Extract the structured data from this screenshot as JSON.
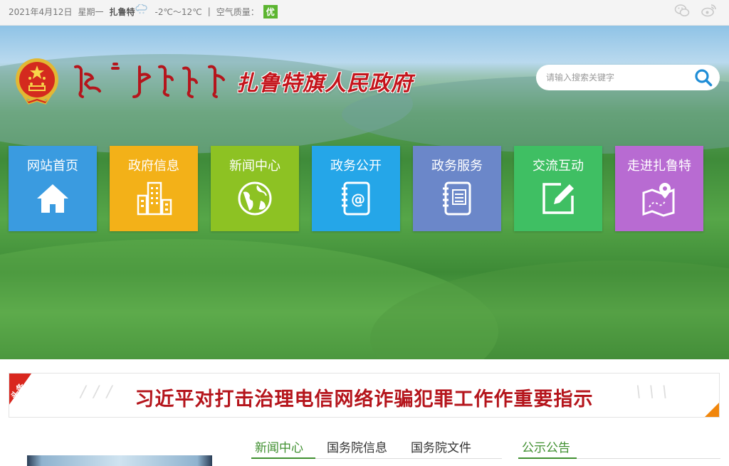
{
  "topbar": {
    "date": "2021年4月12日",
    "weekday": "星期一",
    "city": "扎鲁特",
    "temperature": "-2℃～12℃",
    "divider": "|",
    "air_quality_label": "空气质量：",
    "air_quality_value": "优",
    "air_quality_color": "#5cb531",
    "weather_icon": "snow-cloud-icon",
    "social_icons": [
      "wechat-icon",
      "weibo-icon"
    ]
  },
  "header": {
    "title": "扎鲁特旗人民政府",
    "title_color": "#c4141b",
    "emblem": "national-emblem-icon"
  },
  "search": {
    "placeholder": "请输入搜索关键字",
    "button_icon": "search-icon",
    "icon_color": "#1f8dd6"
  },
  "nav": [
    {
      "label": "网站首页",
      "icon": "home-icon",
      "color": "#3a9be0"
    },
    {
      "label": "政府信息",
      "icon": "buildings-icon",
      "color": "#f3b118"
    },
    {
      "label": "新闻中心",
      "icon": "globe-icon",
      "color": "#8dc223"
    },
    {
      "label": "政务公开",
      "icon": "address-book-icon",
      "color": "#25a6e8"
    },
    {
      "label": "政务服务",
      "icon": "notebook-icon",
      "color": "#6b87c9"
    },
    {
      "label": "交流互动",
      "icon": "edit-icon",
      "color": "#3fbf63"
    },
    {
      "label": "走进扎鲁特",
      "icon": "map-pin-icon",
      "color": "#b86bd2"
    }
  ],
  "headline": {
    "tag": "头条",
    "text": "习近平对打击治理电信网络诈骗犯罪工作作重要指示",
    "text_color": "#b5151c",
    "tag_color": "#d9271e"
  },
  "news_tabs": [
    {
      "label": "新闻中心",
      "active": true
    },
    {
      "label": "国务院信息",
      "active": false
    },
    {
      "label": "国务院文件",
      "active": false
    }
  ],
  "notice_tab": {
    "label": "公示公告"
  },
  "accent_green": "#3f8f2f"
}
